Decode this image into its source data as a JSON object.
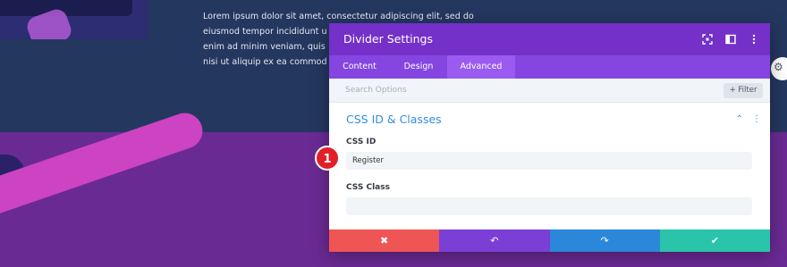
{
  "background": {
    "lorem_lines": [
      "Lorem ipsum dolor sit amet, consectetur adipiscing elit, sed do",
      "eiusmod tempor incididunt u",
      "enim ad minim veniam, quis",
      "nisi ut aliquip ex ea commod"
    ],
    "colors": {
      "top": "#24375f",
      "bottom": "#6a2a93",
      "stripe": "#cc44c2"
    }
  },
  "modal": {
    "title": "Divider Settings",
    "header_icons": [
      "fullscreen-icon",
      "sidebar-icon",
      "more-vertical-icon"
    ],
    "tabs": [
      {
        "label": "Content",
        "active": false
      },
      {
        "label": "Design",
        "active": false
      },
      {
        "label": "Advanced",
        "active": true
      }
    ],
    "search": {
      "placeholder": "Search Options",
      "filter_label": "+ Filter"
    },
    "section": {
      "title": "CSS ID & Classes"
    },
    "fields": {
      "css_id": {
        "label": "CSS ID",
        "value": "Register"
      },
      "css_class": {
        "label": "CSS Class",
        "value": ""
      }
    },
    "actions": [
      {
        "name": "cancel",
        "glyph": "✖",
        "color": "#ef5555"
      },
      {
        "name": "undo",
        "glyph": "↶",
        "color": "#7b3fd6"
      },
      {
        "name": "redo",
        "glyph": "↷",
        "color": "#2b87da"
      },
      {
        "name": "save",
        "glyph": "✔",
        "color": "#29c4a9"
      }
    ],
    "colors": {
      "header": "#7430c9",
      "tabs": "#8545e0",
      "accent": "#2f8ee0"
    }
  },
  "callout": {
    "number": "1"
  }
}
